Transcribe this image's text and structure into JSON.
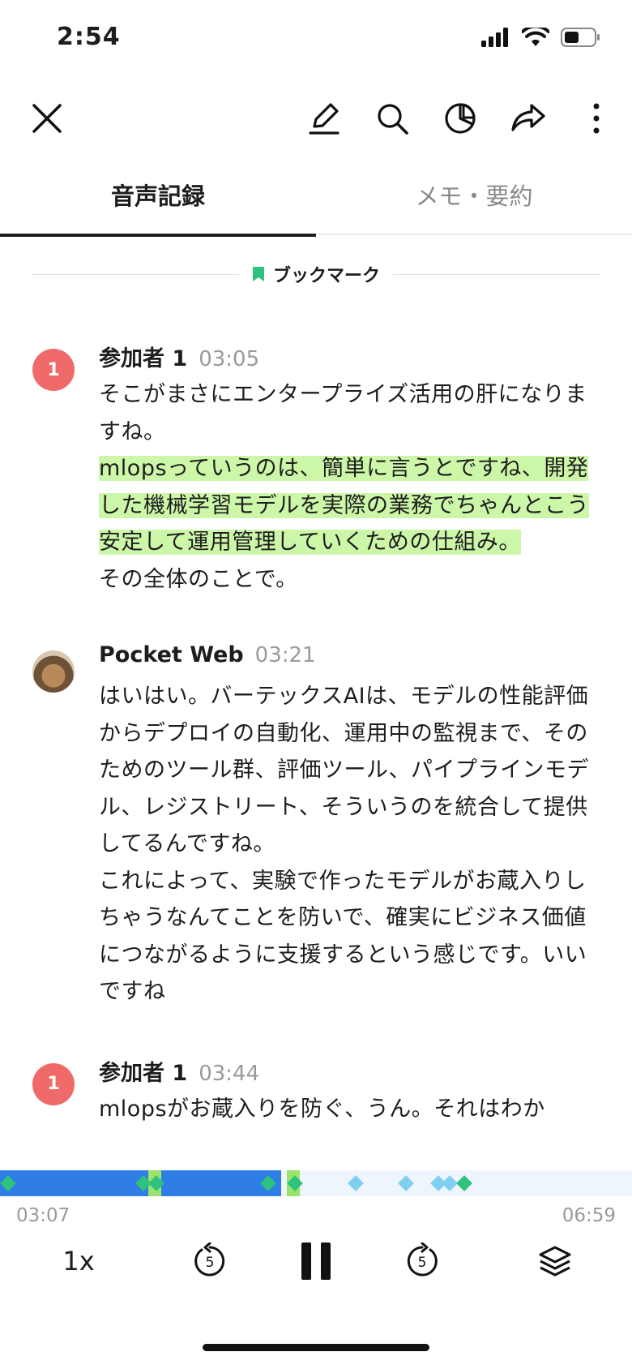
{
  "status_bar": {
    "time": "2:54"
  },
  "tabs": [
    {
      "label": "音声記録",
      "active": true
    },
    {
      "label": "メモ・要約",
      "active": false
    }
  ],
  "bookmark": {
    "label": "ブックマーク",
    "color": "#2ec27e"
  },
  "entries": [
    {
      "speaker": "参加者 1",
      "avatar": "1",
      "timestamp": "03:05",
      "lines": [
        {
          "text": "そこがまさにエンタープライズ活用の肝になりますね。",
          "highlight": false
        },
        {
          "text": "mlopsっていうのは、簡単に言うとですね、開発した機械学習モデルを実際の業務でちゃんとこう安定して運用管理していくための仕組み。",
          "highlight": true
        },
        {
          "text": "その全体のことで。",
          "highlight": false
        }
      ]
    },
    {
      "speaker": "Pocket Web",
      "avatar": "",
      "timestamp": "03:21",
      "lines": [
        {
          "text": "はいはい。バーテックスAIは、モデルの性能評価からデプロイの自動化、運用中の監視まで、そのためのツール群、評価ツール、パイプラインモデル、レジストリート、そういうのを統合して提供してるんですね。",
          "highlight": false
        },
        {
          "text": "これによって、実験で作ったモデルがお蔵入りしちゃうなんてことを防いで、確実にビジネス価値につながるように支援するという感じです。いいですね",
          "highlight": false
        }
      ]
    },
    {
      "speaker": "参加者 1",
      "avatar": "1",
      "timestamp": "03:44",
      "lines": [
        {
          "text": "mlopsがお蔵入りを防ぐ、うん。それはわか",
          "highlight": false
        }
      ]
    }
  ],
  "player": {
    "current_time": "03:07",
    "total_time": "06:59",
    "progress_fraction": 0.445,
    "speed_label": "1x",
    "skip_back_seconds": "5",
    "skip_forward_seconds": "5",
    "played_color": "#2f7de6",
    "highlight_color": "#9be36a"
  }
}
